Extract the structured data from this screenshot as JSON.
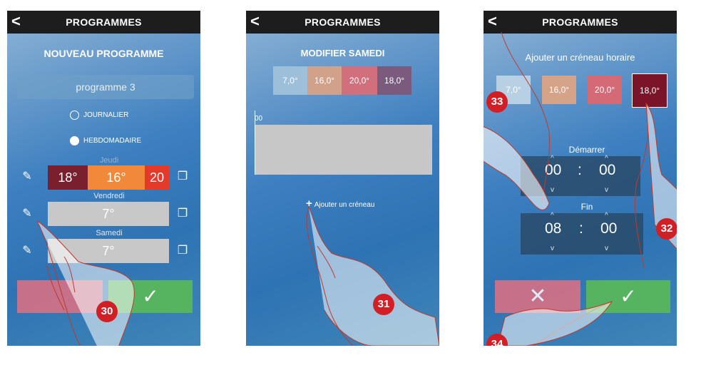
{
  "screens": [
    {
      "header": {
        "back": "<",
        "title": "PROGRAMMES"
      },
      "heading": "NOUVEAU PROGRAMME",
      "name_value": "programme 3",
      "options": [
        "JOURNALIER",
        "HEBDOMADAIRE"
      ],
      "days": [
        {
          "label": "Jeudi",
          "segments": [
            "18°",
            "16°",
            "20"
          ]
        },
        {
          "label": "Vendredi",
          "value": "7°"
        },
        {
          "label": "Samedi",
          "value": "7°"
        }
      ]
    },
    {
      "header": {
        "back": "<",
        "title": "PROGRAMMES"
      },
      "heading": "MODIFIER SAMEDI",
      "temps": [
        "7,0°",
        "16,0°",
        "20,0°",
        "18,0°"
      ],
      "timeline_label": "00",
      "add_slot": "Ajouter un créneau"
    },
    {
      "header": {
        "back": "<",
        "title": "PROGRAMMES"
      },
      "heading": "Ajouter un créneau horaire",
      "temps": [
        "7,0°",
        "16,0°",
        "20,0°",
        "18,0°"
      ],
      "start_label": "Démarrer",
      "start_hour": "00",
      "start_min": "00",
      "end_label": "Fin",
      "end_hour": "08",
      "end_min": "00",
      "colon": ":"
    }
  ],
  "icons": {
    "edit": "✎",
    "copy": "❐",
    "confirm": "✓",
    "cancel": "✕",
    "add": "+",
    "up": "^",
    "down": "v"
  },
  "badges": [
    "30",
    "31",
    "32",
    "33",
    "34"
  ],
  "colors": {
    "accent_red": "#d11f25",
    "confirm_green": "#56b460",
    "cancel_pink": "#e07182",
    "header": "#1d1d1d"
  }
}
